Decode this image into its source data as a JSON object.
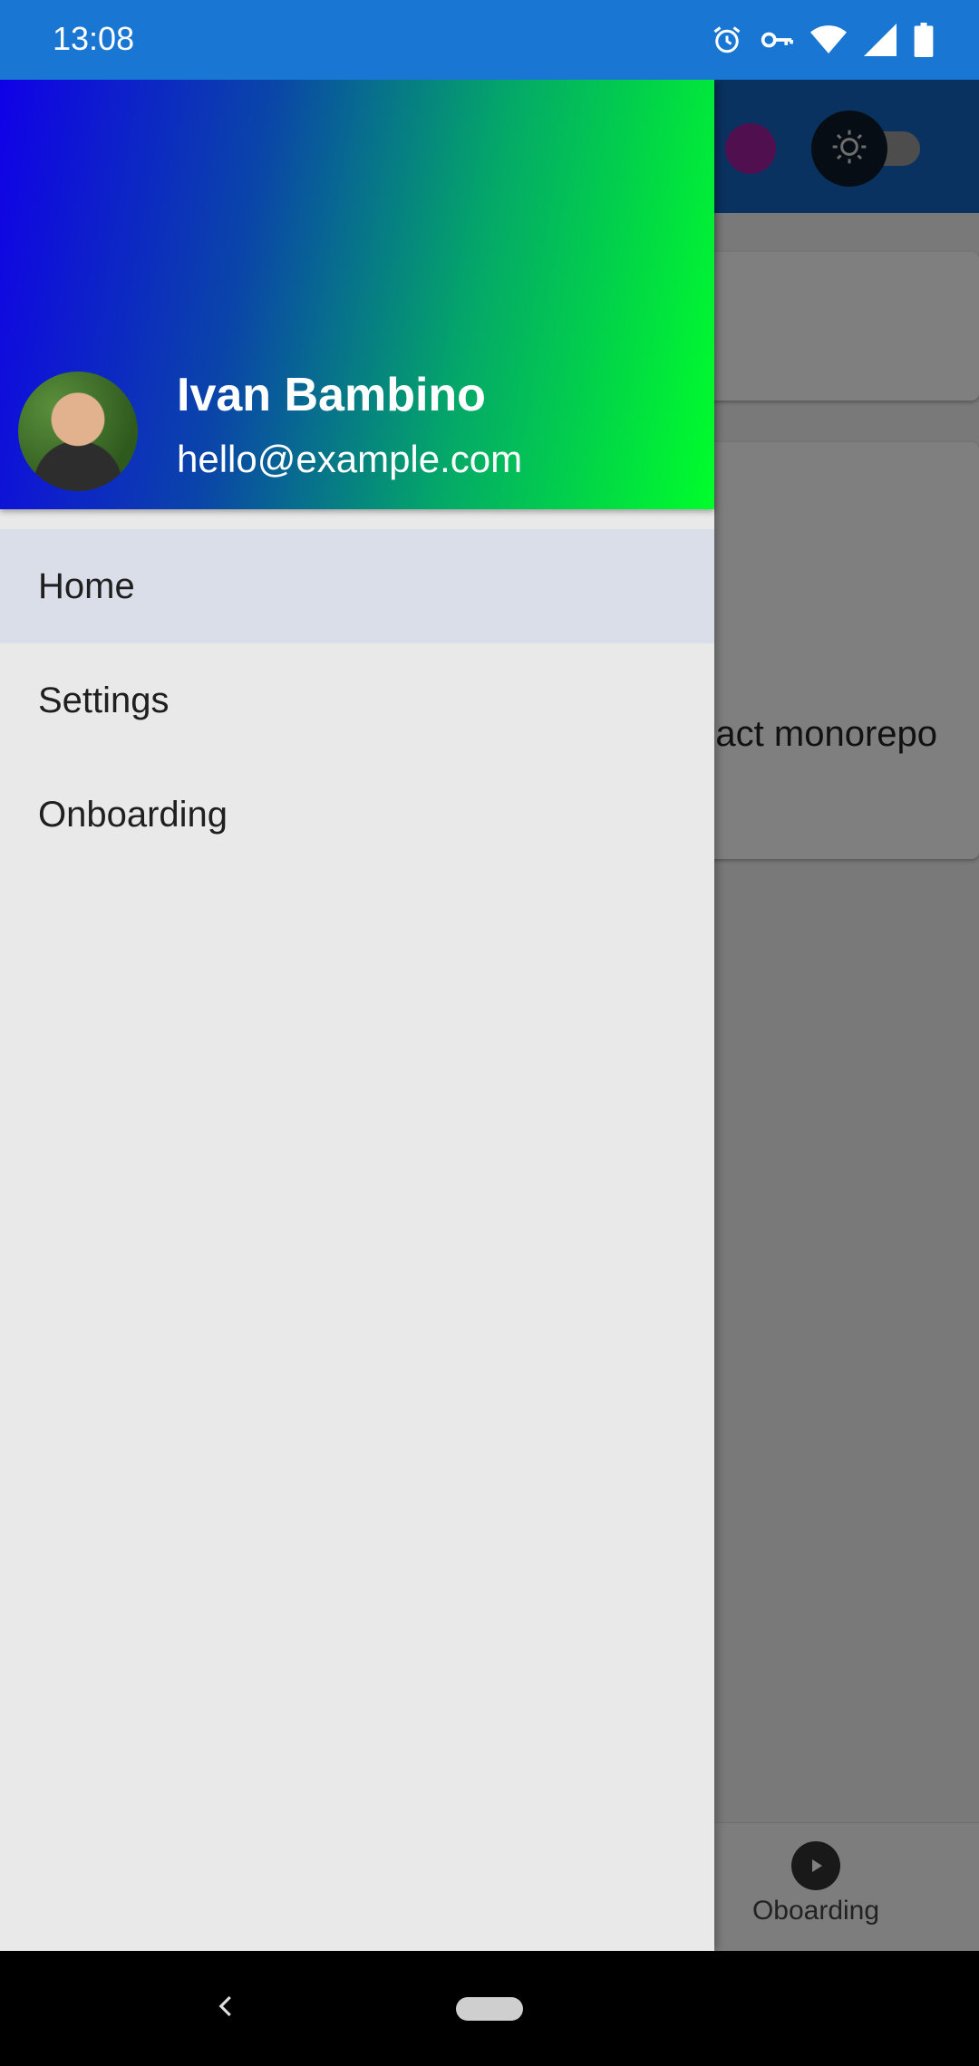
{
  "status_bar": {
    "time": "13:08",
    "icons": [
      "alarm-icon",
      "vpn-key-icon",
      "wifi-icon",
      "signal-icon",
      "battery-icon"
    ]
  },
  "drawer": {
    "header": {
      "name": "Ivan Bambino",
      "email": "hello@example.com",
      "gradient": [
        "#1000e8",
        "#00ff2a"
      ]
    },
    "items": [
      {
        "label": "Home",
        "selected": true
      },
      {
        "label": "Settings",
        "selected": false
      },
      {
        "label": "Onboarding",
        "selected": false
      }
    ]
  },
  "background": {
    "card_text": "act monorepo",
    "bottom_nav_label": "Oboarding"
  },
  "colors": {
    "status_bar": "#1976d2",
    "app_bar": "#1565c0",
    "selected_item": "#d9dee8",
    "drawer_bg": "#e9e9e9"
  }
}
